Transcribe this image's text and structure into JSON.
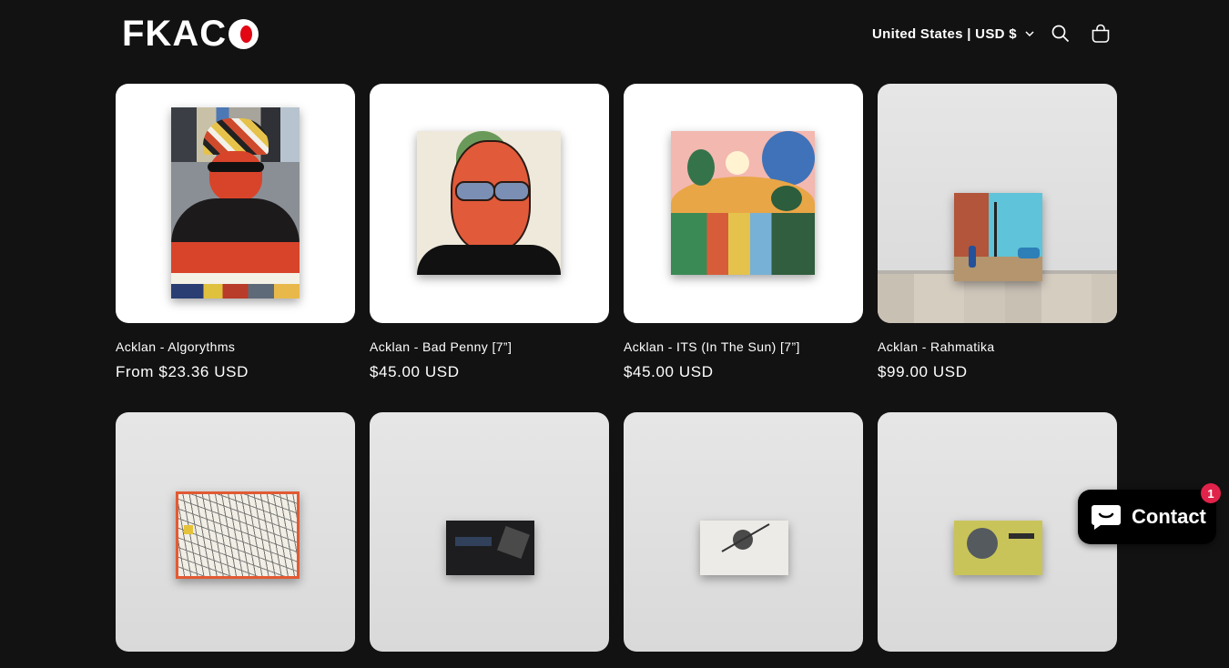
{
  "header": {
    "logo_text": "FKACO",
    "locale": "United States | USD $",
    "icons": [
      "search-icon",
      "cart-icon",
      "chevron-down-icon"
    ]
  },
  "products": [
    {
      "title": "Acklan - Algorythms",
      "price": "From $23.36 USD"
    },
    {
      "title": "Acklan - Bad Penny [7”]",
      "price": "$45.00 USD"
    },
    {
      "title": "Acklan - ITS (In The Sun) [7”]",
      "price": "$45.00 USD"
    },
    {
      "title": "Acklan - Rahmatika",
      "price": "$99.00 USD"
    },
    {
      "title": "",
      "price": ""
    },
    {
      "title": "",
      "price": ""
    },
    {
      "title": "",
      "price": ""
    },
    {
      "title": "",
      "price": ""
    }
  ],
  "chat": {
    "label": "Contact",
    "badge_count": "1",
    "icon": "chat-bubble-icon"
  },
  "colors": {
    "background": "#121212",
    "logo_accent": "#e30613",
    "badge": "#e1224a"
  }
}
